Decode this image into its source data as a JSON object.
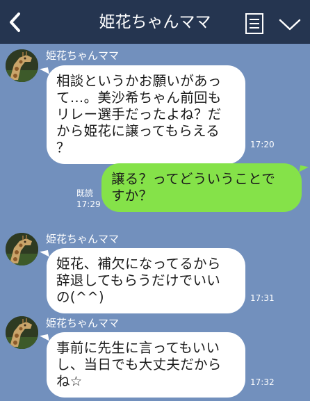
{
  "header": {
    "title": "姫花ちゃんママ",
    "back_icon": "chevron-left-icon",
    "menu_icon": "notes-icon",
    "expand_icon": "chevron-down-icon",
    "background": "#253550"
  },
  "chat": {
    "background": "#7290bd",
    "messages": [
      {
        "direction": "incoming",
        "sender": "姫花ちゃんママ",
        "lines": [
          "相談というかお願いがあっ",
          "て…。美沙希ちゃん前回も",
          "リレー選手だったよね？だ",
          "から姫花に譲ってもらえる",
          "？"
        ],
        "time": "17:20"
      },
      {
        "direction": "outgoing",
        "lines": [
          "譲る？ってどういうことで",
          "すか？"
        ],
        "read": "既読",
        "time": "17:29"
      },
      {
        "direction": "incoming",
        "sender": "姫花ちゃんママ",
        "lines": [
          "姫花、補欠になってるから",
          "辞退してもらうだけでいい",
          "の(^^)"
        ],
        "time": "17:31"
      },
      {
        "direction": "incoming",
        "sender": "姫花ちゃんママ",
        "lines": [
          "事前に先生に言ってもいい",
          "し、当日でも大丈夫だから",
          "ね☆"
        ],
        "time": "17:32"
      }
    ],
    "colors": {
      "incoming_bubble": "#ffffff",
      "outgoing_bubble": "#85e249"
    }
  }
}
